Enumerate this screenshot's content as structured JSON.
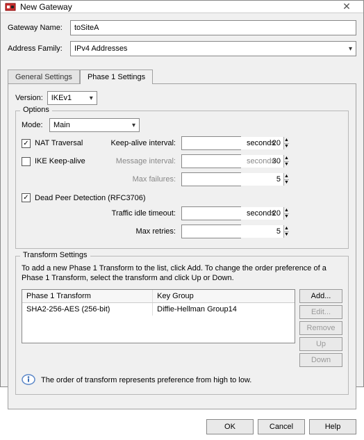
{
  "titlebar": {
    "title": "New Gateway",
    "close": "✕"
  },
  "fields": {
    "gateway_name_label": "Gateway Name:",
    "gateway_name_value": "toSiteA",
    "address_family_label": "Address Family:",
    "address_family_value": "IPv4 Addresses"
  },
  "tabs": {
    "general": "General Settings",
    "phase1": "Phase 1 Settings"
  },
  "version": {
    "label": "Version:",
    "value": "IKEv1"
  },
  "options": {
    "group_title": "Options",
    "mode_label": "Mode:",
    "mode_value": "Main",
    "nat_traversal_label": "NAT Traversal",
    "nat_traversal_checked": true,
    "keepalive_interval_label": "Keep-alive interval:",
    "keepalive_interval_value": "20",
    "ike_keepalive_label": "IKE Keep-alive",
    "ike_keepalive_checked": false,
    "message_interval_label": "Message interval:",
    "message_interval_value": "30",
    "max_failures_label": "Max failures:",
    "max_failures_value": "5",
    "dpd_label": "Dead Peer Detection (RFC3706)",
    "dpd_checked": true,
    "traffic_idle_label": "Traffic idle timeout:",
    "traffic_idle_value": "20",
    "max_retries_label": "Max retries:",
    "max_retries_value": "5",
    "seconds": "seconds"
  },
  "transform": {
    "group_title": "Transform Settings",
    "help": "To add a new Phase 1 Transform to the list, click Add. To change the order preference of a Phase 1 Transform, select the transform and click Up or Down.",
    "col1": "Phase 1 Transform",
    "col2": "Key Group",
    "row1_transform": "SHA2-256-AES (256-bit)",
    "row1_keygroup": "Diffie-Hellman Group14",
    "btn_add": "Add...",
    "btn_edit": "Edit...",
    "btn_remove": "Remove",
    "btn_up": "Up",
    "btn_down": "Down",
    "info": "The order of transform represents preference from high to low."
  },
  "footer": {
    "ok": "OK",
    "cancel": "Cancel",
    "help": "Help"
  }
}
